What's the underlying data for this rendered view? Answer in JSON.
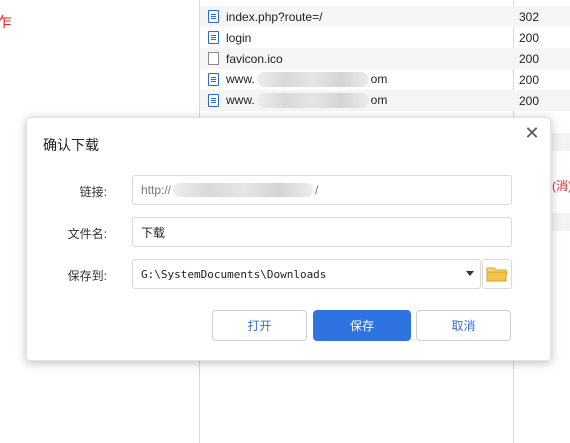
{
  "background": {
    "left_fragment": "乍",
    "right_fragment": "(消)",
    "network_rows": [
      {
        "name": "index.php?route=/",
        "status": "302",
        "icon": "document-icon"
      },
      {
        "name": "login",
        "status": "200",
        "icon": "document-icon"
      },
      {
        "name": "favicon.ico",
        "status": "200",
        "icon": "blank-file-icon"
      },
      {
        "name_prefix": "www.",
        "name_suffix": "om",
        "status": "200",
        "icon": "document-icon"
      },
      {
        "name_prefix": "www.",
        "name_suffix": "om",
        "status": "200",
        "icon": "document-icon"
      }
    ]
  },
  "dialog": {
    "title": "确认下载",
    "close_glyph": "✕",
    "url_label": "链接:",
    "url_value": "http://",
    "url_suffix": "/",
    "filename_label": "文件名:",
    "filename_value": "下载",
    "saveto_label": "保存到:",
    "saveto_value": "G:\\SystemDocuments\\Downloads",
    "open_label": "打开",
    "save_label": "保存",
    "cancel_label": "取消"
  },
  "colors": {
    "primary": "#2f73e0",
    "link_text": "#2f73d6",
    "folder": "#f3c24a",
    "red_text": "#e02424"
  }
}
